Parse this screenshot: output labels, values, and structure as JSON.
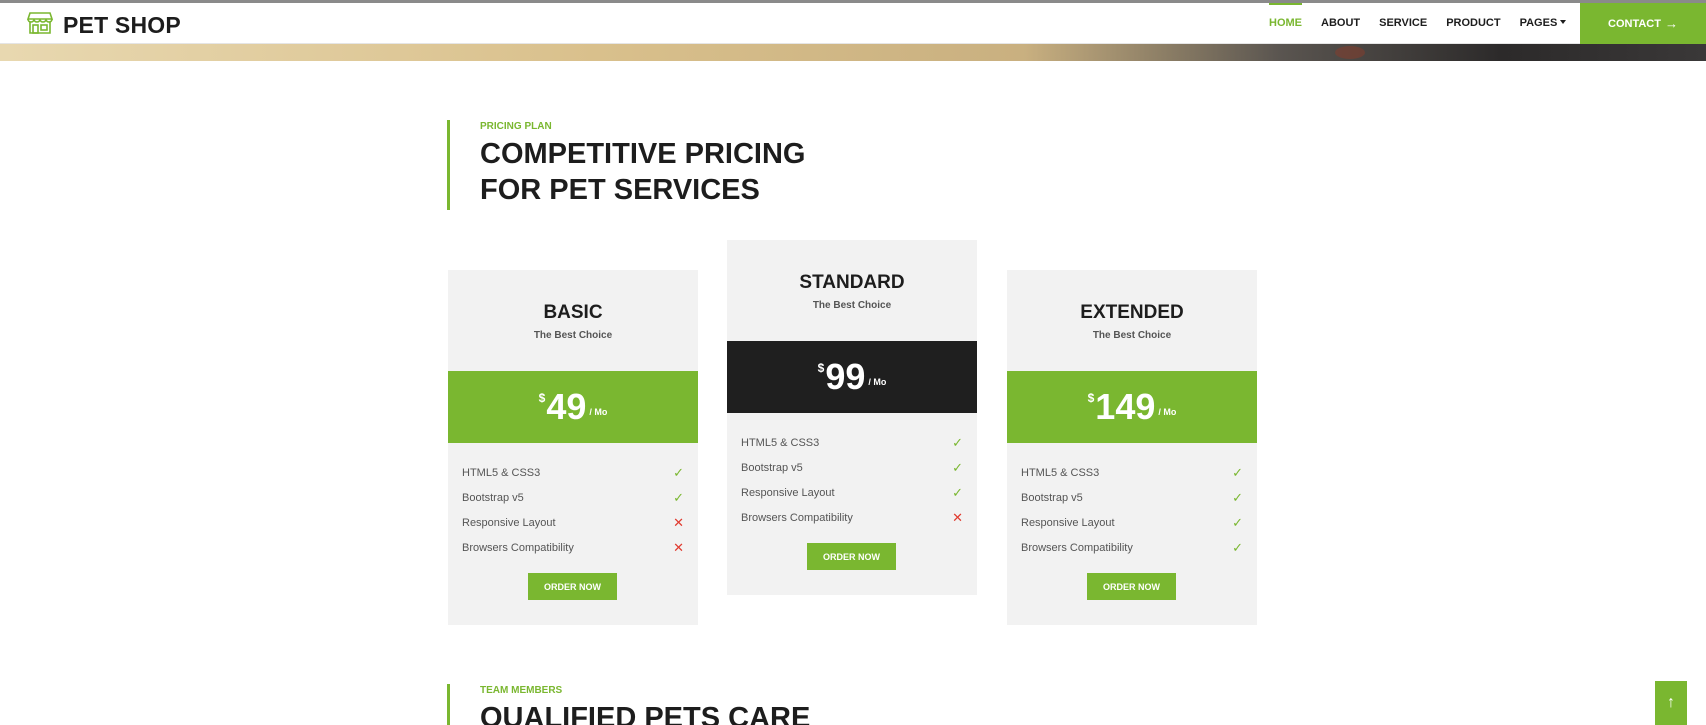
{
  "brand": {
    "name": "PET SHOP",
    "icon": "storefront-icon"
  },
  "nav": {
    "items": [
      {
        "label": "HOME",
        "active": true
      },
      {
        "label": "ABOUT",
        "active": false
      },
      {
        "label": "SERVICE",
        "active": false
      },
      {
        "label": "PRODUCT",
        "active": false
      },
      {
        "label": "PAGES",
        "active": false,
        "dropdown": true
      }
    ],
    "contact_label": "CONTACT",
    "contact_icon": "arrow-right-icon"
  },
  "pricing": {
    "subtitle": "PRICING PLAN",
    "title_line1": "COMPETITIVE PRICING",
    "title_line2": "FOR PET SERVICES"
  },
  "plans": [
    {
      "name": "BASIC",
      "tagline": "The Best Choice",
      "currency": "$",
      "price": "49",
      "period": "/ Mo",
      "price_bg": "#7ab730",
      "features": [
        {
          "label": "HTML5 & CSS3",
          "included": true
        },
        {
          "label": "Bootstrap v5",
          "included": true
        },
        {
          "label": "Responsive Layout",
          "included": false
        },
        {
          "label": "Browsers Compatibility",
          "included": false
        }
      ],
      "button": "ORDER NOW"
    },
    {
      "name": "STANDARD",
      "tagline": "The Best Choice",
      "currency": "$",
      "price": "99",
      "period": "/ Mo",
      "price_bg": "#1f1f1f",
      "features": [
        {
          "label": "HTML5 & CSS3",
          "included": true
        },
        {
          "label": "Bootstrap v5",
          "included": true
        },
        {
          "label": "Responsive Layout",
          "included": true
        },
        {
          "label": "Browsers Compatibility",
          "included": false
        }
      ],
      "button": "ORDER NOW"
    },
    {
      "name": "EXTENDED",
      "tagline": "The Best Choice",
      "currency": "$",
      "price": "149",
      "period": "/ Mo",
      "price_bg": "#7ab730",
      "features": [
        {
          "label": "HTML5 & CSS3",
          "included": true
        },
        {
          "label": "Bootstrap v5",
          "included": true
        },
        {
          "label": "Responsive Layout",
          "included": true
        },
        {
          "label": "Browsers Compatibility",
          "included": true
        }
      ],
      "button": "ORDER NOW"
    }
  ],
  "team": {
    "subtitle": "TEAM MEMBERS",
    "title": "QUALIFIED PETS CARE"
  },
  "back_to_top_icon": "arrow-up-icon",
  "colors": {
    "accent": "#7ab730",
    "dark": "#1f1f1f",
    "card_bg": "#f2f2f2",
    "cross": "#e03a2e"
  }
}
